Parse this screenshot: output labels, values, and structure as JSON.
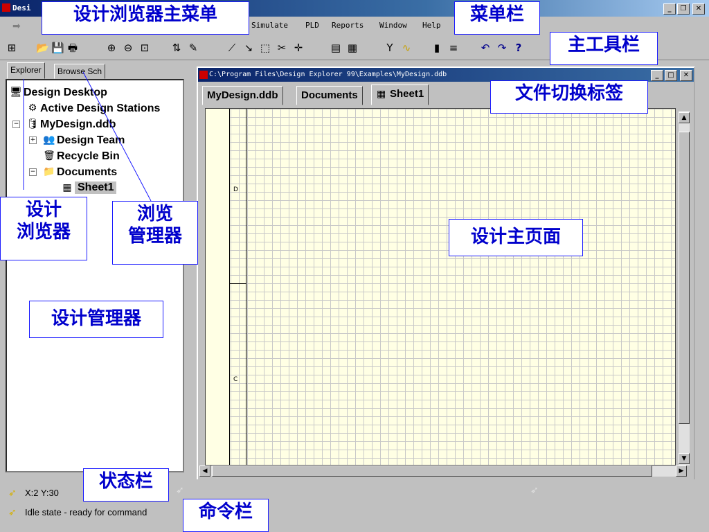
{
  "app": {
    "title": "Desi"
  },
  "menu": [
    {
      "key": "simulate",
      "label": "Simulate"
    },
    {
      "key": "pld",
      "label": "PLD"
    },
    {
      "key": "reports",
      "label": "Reports"
    },
    {
      "key": "window",
      "label": "Window"
    },
    {
      "key": "help",
      "label": "Help"
    }
  ],
  "left_tabs": {
    "explorer": "Explorer",
    "browse": "Browse Sch"
  },
  "tree": {
    "desktop": "Design Desktop",
    "stations": "Active Design Stations",
    "ddb": "MyDesign.ddb",
    "team": "Design Team",
    "recycle": "Recycle Bin",
    "documents": "Documents",
    "sheet": "Sheet1"
  },
  "doc": {
    "path": "C:\\Program Files\\Design Explorer 99\\Examples\\MyDesign.ddb",
    "tabs": [
      "MyDesign.ddb",
      "Documents",
      "Sheet1"
    ],
    "border_marks": [
      "D",
      "C"
    ]
  },
  "status": {
    "coords": "X:2 Y:30",
    "command": "Idle state - ready for command"
  },
  "annotations": {
    "main_menu": "设计浏览器主菜单",
    "menubar": "菜单栏",
    "main_toolbar": "主工具栏",
    "file_tabs": "文件切换标签",
    "explorer_l1": "设计",
    "explorer_l2": "浏览器",
    "browse_l1": "浏览",
    "browse_l2": "管理器",
    "design_manager": "设计管理器",
    "main_page": "设计主页面",
    "statusbar": "状态栏",
    "commandbar": "命令栏"
  },
  "colors": {
    "title_start": "#0a246a",
    "title_end": "#a6caf0",
    "annotation_text": "#0000cc",
    "sheet_bg": "#ffffe4"
  },
  "icons": [
    "app-icon",
    "minimize-icon",
    "restore-icon",
    "close-icon",
    "folder-open-icon",
    "save-icon",
    "print-icon",
    "zoom-in-icon",
    "zoom-out-icon",
    "zoom-fit-icon",
    "undo-icon",
    "redo-icon",
    "help-icon"
  ]
}
